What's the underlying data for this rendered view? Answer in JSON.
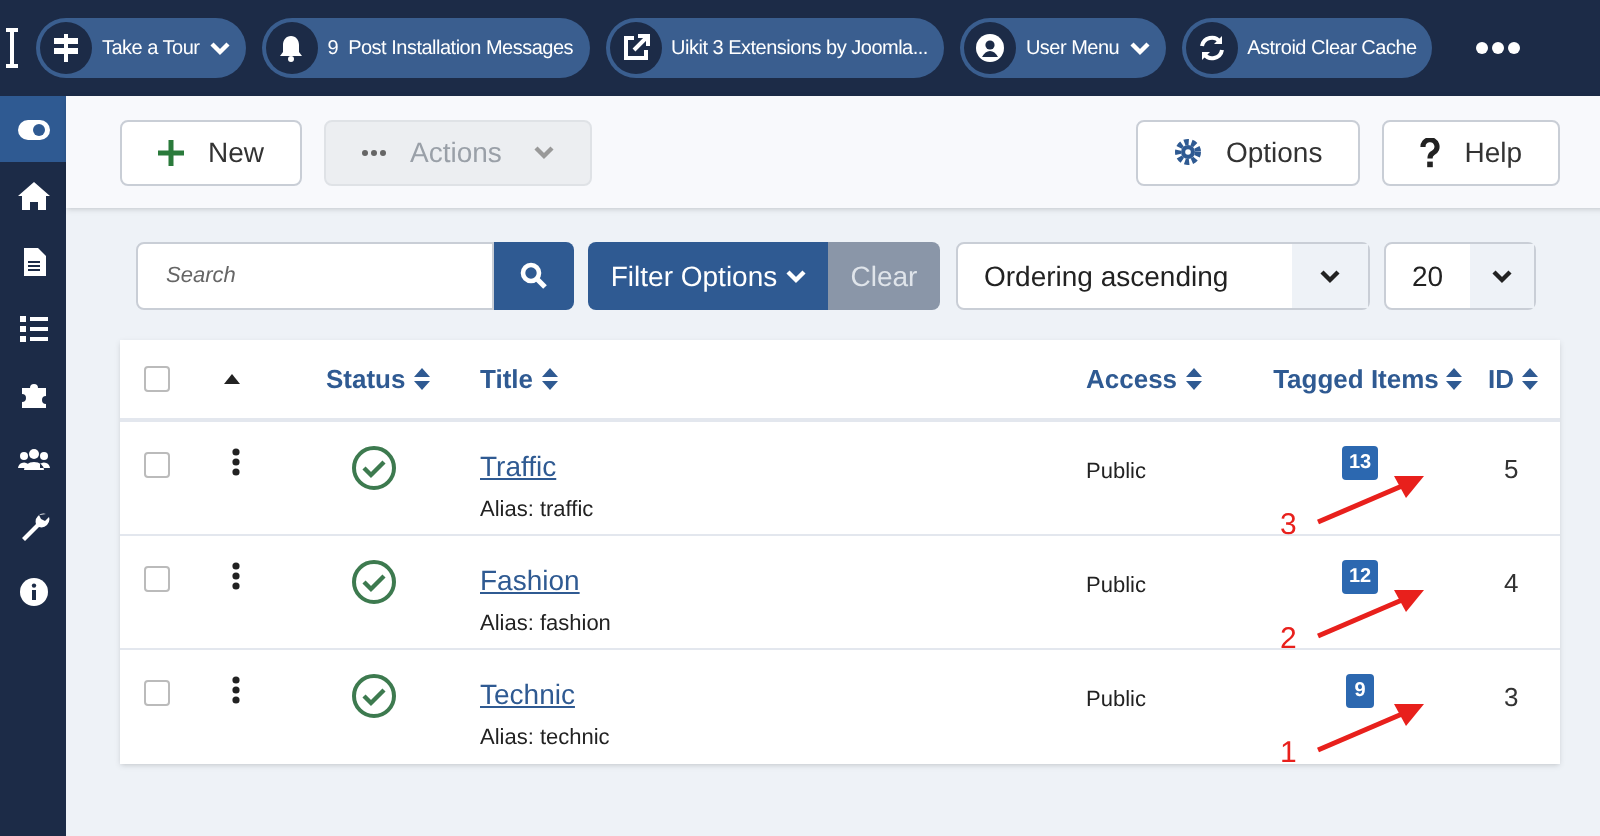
{
  "topbar": {
    "items": [
      {
        "label": "Take a Tour",
        "dropdown": true
      },
      {
        "label": "Post Installation Messages",
        "count": "9",
        "dropdown": false
      },
      {
        "label": "Uikit 3 Extensions by Joomla...",
        "dropdown": false
      },
      {
        "label": "User Menu",
        "dropdown": true
      },
      {
        "label": "Astroid Clear Cache",
        "dropdown": false
      }
    ]
  },
  "sidebar": {
    "items": [
      {
        "selected": true
      },
      {
        "selected": false
      },
      {
        "selected": false
      },
      {
        "selected": false
      },
      {
        "selected": false
      },
      {
        "selected": false
      },
      {
        "selected": false
      },
      {
        "selected": false
      }
    ]
  },
  "toolbar": {
    "left": [
      {
        "label": "New",
        "disabled": false
      },
      {
        "label": "Actions",
        "disabled": true
      }
    ],
    "right": [
      {
        "label": "Options",
        "disabled": false
      },
      {
        "label": "Help",
        "disabled": false
      }
    ]
  },
  "filters": {
    "search": {
      "placeholder": "Search"
    },
    "filter_button": "Filter Options",
    "clear_button": "Clear",
    "ordering": "Ordering ascending",
    "limit": "20"
  },
  "table": {
    "select_all": {
      "checked": false
    },
    "columns": [
      "Status",
      "Title",
      "Access",
      "Tagged Items",
      "ID"
    ],
    "rows": [
      {
        "checked": false,
        "published": true,
        "title": "Traffic",
        "alias": "Alias: traffic",
        "access": "Public",
        "tagged": "13",
        "id": "5",
        "annotation": "3"
      },
      {
        "checked": false,
        "published": true,
        "title": "Fashion",
        "alias": "Alias: fashion",
        "access": "Public",
        "tagged": "12",
        "id": "4",
        "annotation": "2"
      },
      {
        "checked": false,
        "published": true,
        "title": "Technic",
        "alias": "Alias: technic",
        "access": "Public",
        "tagged": "9",
        "id": "3",
        "annotation": "1"
      }
    ]
  }
}
